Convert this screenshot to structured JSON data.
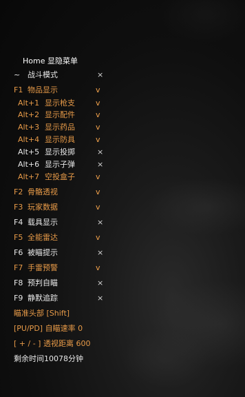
{
  "menu": {
    "title": "Home 显隐菜单",
    "items": [
      {
        "key": "~",
        "label": "战斗模式",
        "state": "×"
      },
      {
        "key": "F1",
        "label": "物品显示",
        "state": "v"
      },
      {
        "key": "Alt+1",
        "label": "显示枪支",
        "state": "v"
      },
      {
        "key": "Alt+2",
        "label": "显示配件",
        "state": "v"
      },
      {
        "key": "Alt+3",
        "label": "显示药品",
        "state": "v"
      },
      {
        "key": "Alt+4",
        "label": "显示防具",
        "state": "v"
      },
      {
        "key": "Alt+5",
        "label": "显示投掷",
        "state": "×"
      },
      {
        "key": "Alt+6",
        "label": "显示子弹",
        "state": "×"
      },
      {
        "key": "Alt+7",
        "label": "空投盒子",
        "state": "v"
      },
      {
        "key": "F2",
        "label": "骨骼透视",
        "state": "v"
      },
      {
        "key": "F3",
        "label": "玩家数据",
        "state": "v"
      },
      {
        "key": "F4",
        "label": "载具显示",
        "state": "×"
      },
      {
        "key": "F5",
        "label": "全能雷达",
        "state": "v"
      },
      {
        "key": "F6",
        "label": "被瞄提示",
        "state": "×"
      },
      {
        "key": "F7",
        "label": "手雷预警",
        "state": "v"
      },
      {
        "key": "F8",
        "label": "预判自瞄",
        "state": "×"
      },
      {
        "key": "F9",
        "label": "静默追踪",
        "state": "×"
      }
    ],
    "aim_head": "瞄准头部 [Shift]",
    "aim_speed": "[PU/PD] 自瞄速率  0",
    "view_distance": "[ + / - ] 透视距离  600",
    "time_left": "剩余时间10078分钟"
  }
}
